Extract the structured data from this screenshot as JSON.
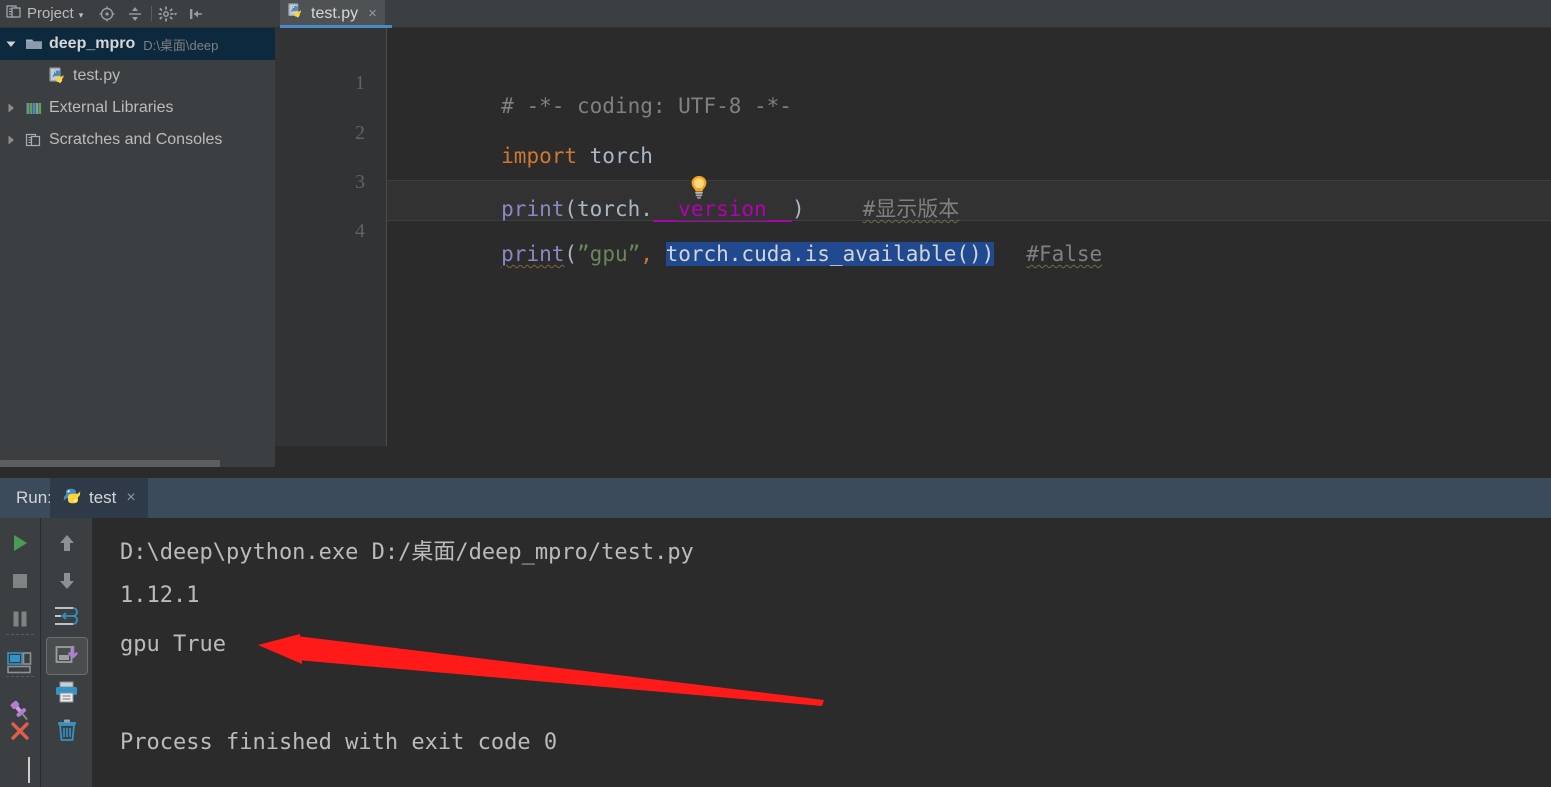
{
  "window": {
    "theme_background": "#2b2b2b",
    "panel_background": "#3c3f41",
    "accent": "#4a88c7"
  },
  "project_panel": {
    "title": "Project",
    "title_caret": "▾",
    "toolbar_icons": [
      {
        "name": "locate-icon",
        "label": "Select Opened File"
      },
      {
        "name": "collapse-all-icon",
        "label": "Collapse All"
      },
      {
        "name": "gear-icon",
        "label": "Settings"
      },
      {
        "name": "hide-panel-icon",
        "label": "Hide"
      }
    ],
    "tree": [
      {
        "name": "deep_mpro",
        "path": "D:\\桌面\\deep",
        "arrow": "▼",
        "icon": "folder-icon",
        "selected": true,
        "level": 0
      },
      {
        "name": "test.py",
        "path": "",
        "arrow": "",
        "icon": "python-file-icon",
        "selected": false,
        "level": 2
      },
      {
        "name": "External Libraries",
        "path": "",
        "arrow": "▶",
        "icon": "libraries-icon",
        "selected": false,
        "level": 0
      },
      {
        "name": "Scratches and Consoles",
        "path": "",
        "arrow": "▶",
        "icon": "scratches-icon",
        "selected": false,
        "level": 0
      }
    ]
  },
  "editor": {
    "tab": {
      "label": "test.py",
      "close": "×",
      "icon": "python-file-icon"
    },
    "line_numbers": [
      "1",
      "2",
      "3",
      "4"
    ],
    "code": {
      "line1_comment": "# -*- coding: UTF-8 -*-",
      "line2_keyword": "import",
      "line2_module": " torch",
      "line3_func": "print",
      "line3_open": "(torch.",
      "line3_magic": "__version__",
      "line3_close": ")",
      "line3_comment": "#显示版本",
      "line4_func": "print",
      "line4_paren": "(",
      "line4_string": "”gpu”",
      "line4_comma": ",",
      "line4_selected": "torch.cuda.is_available()",
      "line4_close": ")",
      "line4_comment": "#False"
    },
    "intention_bulb": "lightbulb-icon"
  },
  "run_panel": {
    "label": "Run:",
    "tab": {
      "label": "test",
      "close": "×",
      "icon": "python-run-icon"
    },
    "side_buttons_col1": [
      {
        "name": "rerun-button",
        "icon": "play-icon",
        "color": "#499c54"
      },
      {
        "name": "stop-button",
        "icon": "stop-square-icon",
        "color": "#7f8384"
      },
      {
        "name": "pause-button",
        "icon": "pause-icon",
        "color": "#7f8384"
      },
      {
        "name": "toggle-tasks-button",
        "icon": "tasks-view-icon",
        "color": "#3592c4"
      },
      {
        "name": "pin-tab-button",
        "icon": "pin-icon",
        "color": "#b07fd0"
      },
      {
        "name": "close-button",
        "icon": "close-x-icon",
        "color": "#e05c4b"
      }
    ],
    "side_buttons_col2": [
      {
        "name": "up-stack-button",
        "icon": "arrow-up-icon",
        "color": "#8c9194"
      },
      {
        "name": "down-stack-button",
        "icon": "arrow-down-icon",
        "color": "#8c9194"
      },
      {
        "name": "soft-wrap-button",
        "icon": "soft-wrap-icon",
        "color": "#3592c4"
      },
      {
        "name": "scroll-to-end-button",
        "icon": "scroll-to-end-icon",
        "color": "#b07fd0",
        "selected": true
      },
      {
        "name": "print-button",
        "icon": "printer-icon",
        "color": "#3592c4"
      },
      {
        "name": "clear-all-button",
        "icon": "trash-icon",
        "color": "#3592c4"
      }
    ],
    "console_output": [
      "D:\\deep\\python.exe D:/桌面/deep_mpro/test.py",
      "1.12.1",
      "gpu True",
      "",
      "Process finished with exit code 0"
    ]
  },
  "annotation": {
    "name": "red-arrow",
    "color": "#ff1a1a",
    "points_at": "gpu True"
  }
}
